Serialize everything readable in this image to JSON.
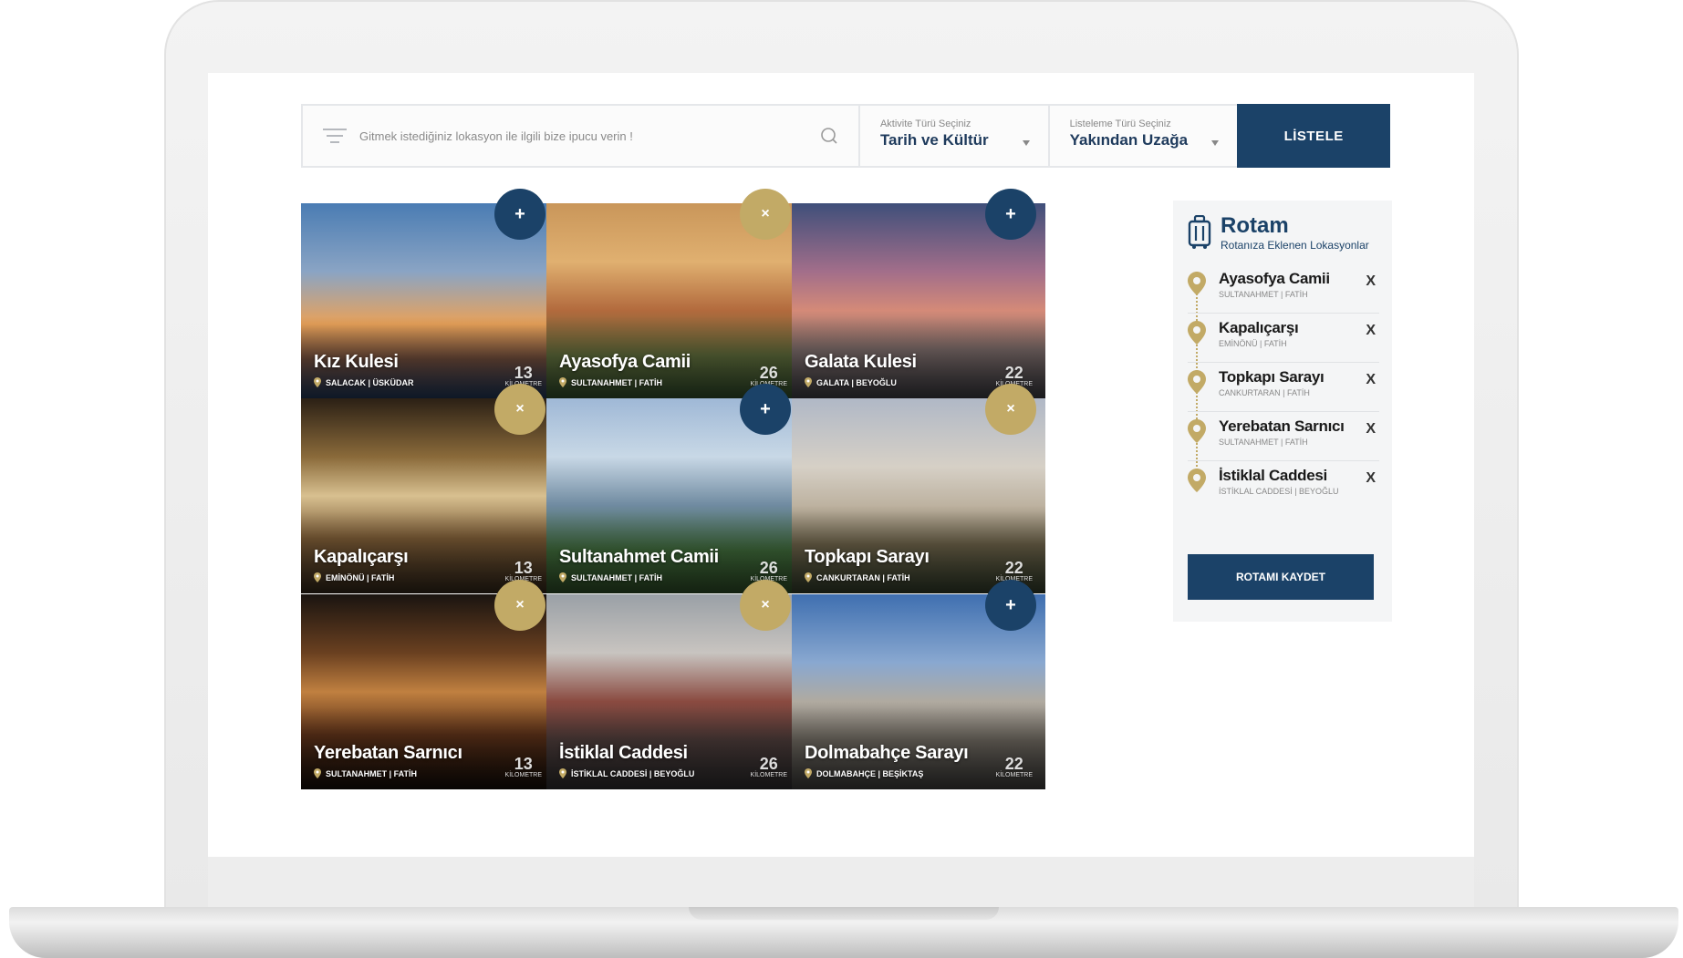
{
  "search": {
    "placeholder": "Gitmek istediğiniz lokasyon ile ilgili bize ipucu verin !"
  },
  "activity_select": {
    "caption": "Aktivite Türü Seçiniz",
    "value": "Tarih ve Kültür"
  },
  "sort_select": {
    "caption": "Listeleme Türü Seçiniz",
    "value": "Yakından Uzağa"
  },
  "list_button_label": "LİSTELE",
  "cards": [
    {
      "title": "Kız Kulesi",
      "location": "SALACAK | ÜSKÜDAR",
      "distance": "13",
      "unit": "KİLOMETRE",
      "action": "+",
      "state": "add"
    },
    {
      "title": "Ayasofya Camii",
      "location": "SULTANAHMET | FATİH",
      "distance": "26",
      "unit": "KİLOMETRE",
      "action": "×",
      "state": "remove"
    },
    {
      "title": "Galata Kulesi",
      "location": "GALATA | BEYOĞLU",
      "distance": "22",
      "unit": "KİLOMETRE",
      "action": "+",
      "state": "add"
    },
    {
      "title": "Kapalıçarşı",
      "location": "EMİNÖNÜ | FATİH",
      "distance": "13",
      "unit": "KİLOMETRE",
      "action": "×",
      "state": "remove"
    },
    {
      "title": "Sultanahmet Camii",
      "location": "SULTANAHMET | FATİH",
      "distance": "26",
      "unit": "KİLOMETRE",
      "action": "+",
      "state": "add"
    },
    {
      "title": "Topkapı Sarayı",
      "location": "CANKURTARAN | FATİH",
      "distance": "22",
      "unit": "KİLOMETRE",
      "action": "×",
      "state": "remove"
    },
    {
      "title": "Yerebatan Sarnıcı",
      "location": "SULTANAHMET | FATİH",
      "distance": "13",
      "unit": "KİLOMETRE",
      "action": "×",
      "state": "remove"
    },
    {
      "title": "İstiklal Caddesi",
      "location": "İSTİKLAL CADDESİ | BEYOĞLU",
      "distance": "26",
      "unit": "KİLOMETRE",
      "action": "×",
      "state": "remove"
    },
    {
      "title": "Dolmabahçe Sarayı",
      "location": "DOLMABAHÇE | BEŞİKTAŞ",
      "distance": "22",
      "unit": "KİLOMETRE",
      "action": "+",
      "state": "add"
    }
  ],
  "route": {
    "title": "Rotam",
    "subtitle": "Rotanıza Eklenen Lokasyonlar",
    "items": [
      {
        "name": "Ayasofya Camii",
        "place": "SULTANAHMET | FATİH",
        "remove": "X"
      },
      {
        "name": "Kapalıçarşı",
        "place": "EMİNÖNÜ | FATİH",
        "remove": "X"
      },
      {
        "name": "Topkapı Sarayı",
        "place": "CANKURTARAN | FATİH",
        "remove": "X"
      },
      {
        "name": "Yerebatan Sarnıcı",
        "place": "SULTANAHMET | FATİH",
        "remove": "X"
      },
      {
        "name": "İstiklal Caddesi",
        "place": "İSTİKLAL CADDESİ | BEYOĞLU",
        "remove": "X"
      }
    ],
    "save_label": "ROTAMI KAYDET"
  },
  "colors": {
    "navy": "#1b4268",
    "gold": "#c2aa66",
    "panel": "#f4f5f6"
  }
}
